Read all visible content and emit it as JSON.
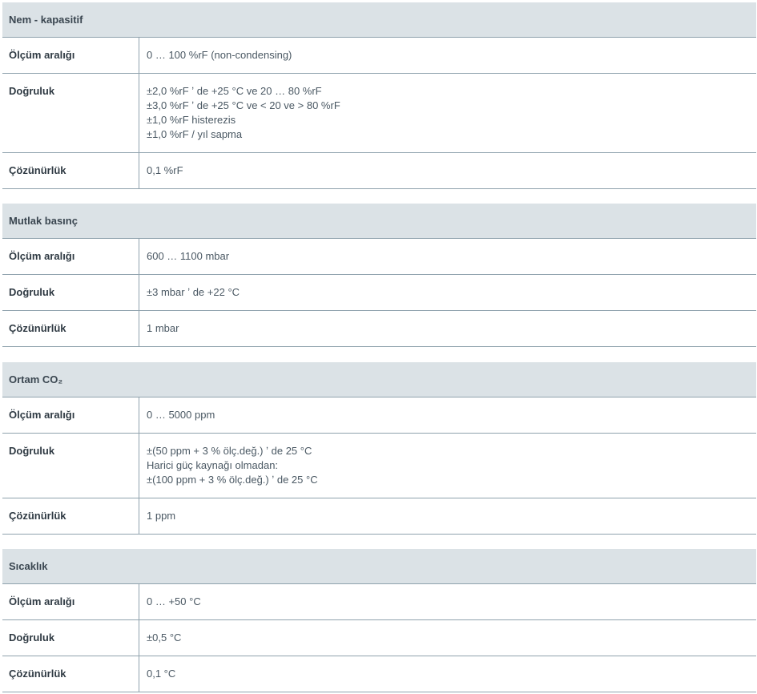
{
  "sections": [
    {
      "title": "Nem - kapasitif",
      "rows": [
        {
          "label": "Ölçüm aralığı",
          "lines": [
            "0 … 100 %rF (non-condensing)"
          ]
        },
        {
          "label": "Doğruluk",
          "lines": [
            "±2,0 %rF ʼ de +25 °C ve 20 … 80 %rF",
            "±3,0 %rF ʼ de +25 °C ve < 20 ve > 80 %rF",
            "±1,0 %rF histerezis",
            "±1,0 %rF / yıl sapma"
          ]
        },
        {
          "label": "Çözünürlük",
          "lines": [
            "0,1 %rF"
          ]
        }
      ]
    },
    {
      "title": "Mutlak basınç",
      "rows": [
        {
          "label": "Ölçüm aralığı",
          "lines": [
            "600 … 1100 mbar"
          ]
        },
        {
          "label": "Doğruluk",
          "lines": [
            "±3 mbar ʼ de +22 °C"
          ]
        },
        {
          "label": "Çözünürlük",
          "lines": [
            "1 mbar"
          ]
        }
      ]
    },
    {
      "title": "Ortam CO₂",
      "rows": [
        {
          "label": "Ölçüm aralığı",
          "lines": [
            "0 … 5000 ppm"
          ]
        },
        {
          "label": "Doğruluk",
          "lines": [
            "±(50 ppm + 3 % ölç.değ.) ʼ de 25 °C",
            "Harici güç kaynağı olmadan:",
            "±(100 ppm + 3 % ölç.değ.) ʼ de 25 °C"
          ]
        },
        {
          "label": "Çözünürlük",
          "lines": [
            "1 ppm"
          ]
        }
      ]
    },
    {
      "title": "Sıcaklık",
      "rows": [
        {
          "label": "Ölçüm aralığı",
          "lines": [
            "0 … +50 °C"
          ]
        },
        {
          "label": "Doğruluk",
          "lines": [
            "±0,5 °C"
          ]
        },
        {
          "label": "Çözünürlük",
          "lines": [
            "0,1 °C"
          ]
        }
      ]
    }
  ]
}
